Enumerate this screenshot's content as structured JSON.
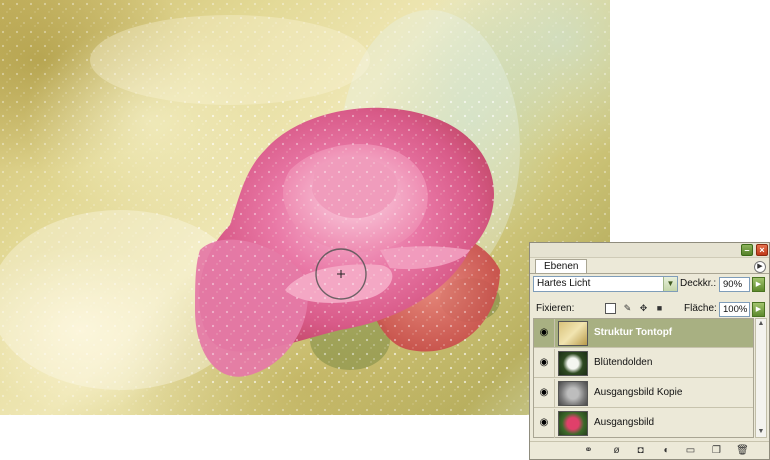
{
  "panel": {
    "tab_label": "Ebenen",
    "blend_mode": "Hartes Licht",
    "opacity_label": "Deckkr.:",
    "opacity_value": "90%",
    "lock_label": "Fixieren:",
    "fill_label": "Fläche:",
    "fill_value": "100%",
    "layers": [
      {
        "name": "Struktur Tontopf",
        "selected": true
      },
      {
        "name": "Blütendolden",
        "selected": false
      },
      {
        "name": "Ausgangsbild Kopie",
        "selected": false
      },
      {
        "name": "Ausgangsbild",
        "selected": false
      }
    ]
  },
  "icons": {
    "titlebar": [
      "minimize-icon",
      "close-icon"
    ],
    "panel_menu": "panel-menu-icon",
    "locks": [
      "lock-transparency-icon",
      "lock-brush-icon",
      "lock-move-icon",
      "lock-all-icon"
    ],
    "bottom": [
      "link-layers-icon",
      "layer-style-icon",
      "layer-mask-icon",
      "adjustment-layer-icon",
      "new-group-icon",
      "new-layer-icon",
      "delete-layer-icon"
    ]
  },
  "colors": {
    "selected_layer": "#a8b082",
    "panel_bg": "#ece9d8",
    "close_button": "#d04a26",
    "minimize_button": "#6e9a3a"
  }
}
